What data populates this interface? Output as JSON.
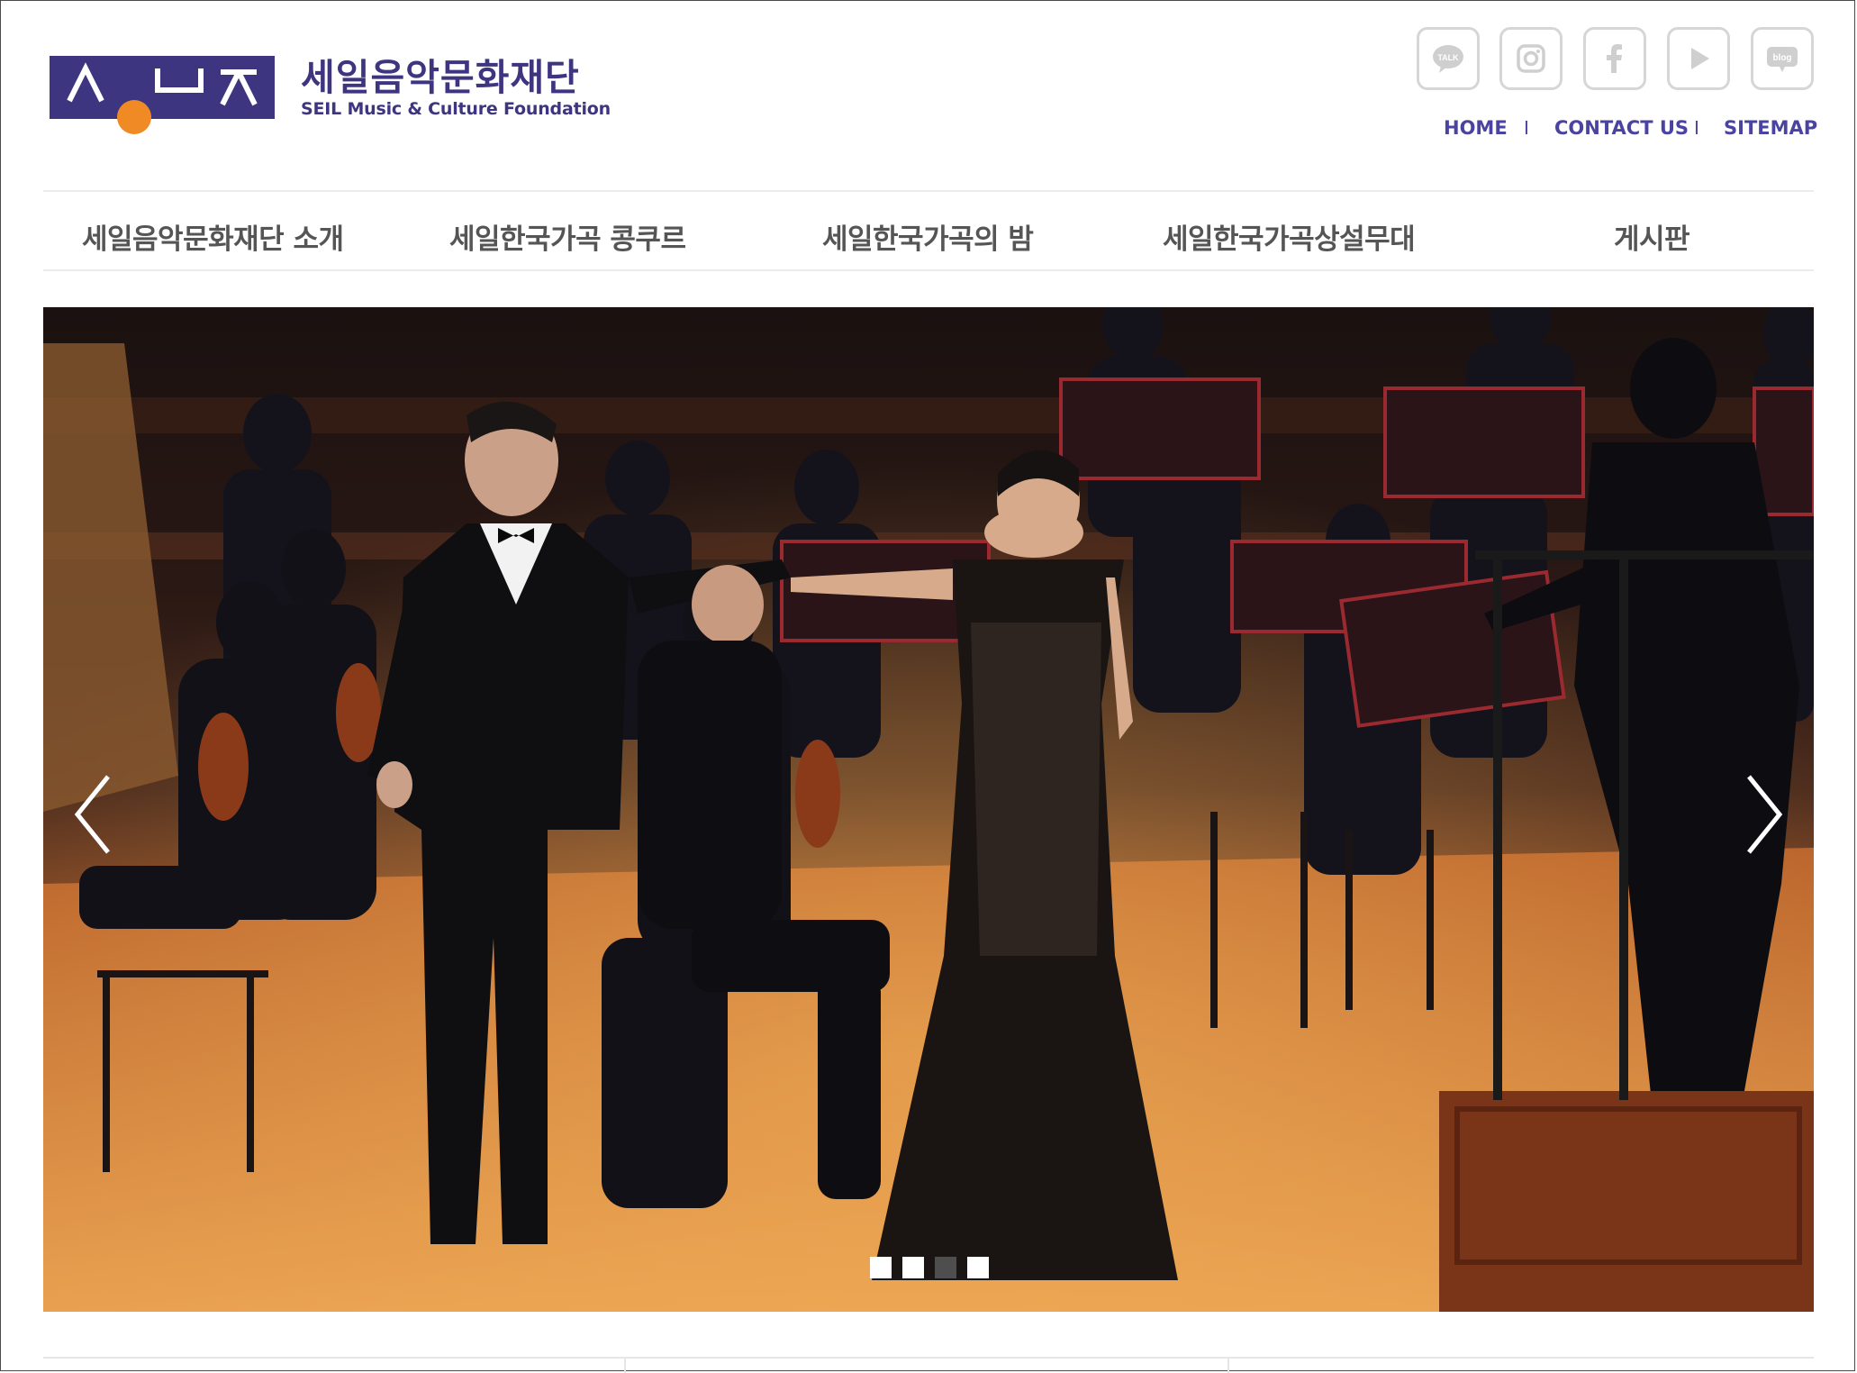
{
  "header": {
    "org_name_ko": "세일음악문화재단",
    "org_name_en": "SEIL Music & Culture Foundation",
    "brand_color": "#3e3580",
    "logo_dot_color": "#f08a24",
    "social": [
      {
        "name": "kakaotalk-icon",
        "label": "TALK"
      },
      {
        "name": "instagram-icon",
        "label": ""
      },
      {
        "name": "facebook-icon",
        "label": "f"
      },
      {
        "name": "youtube-icon",
        "label": ""
      },
      {
        "name": "blog-icon",
        "label": "blog"
      }
    ],
    "util_links": {
      "home": "HOME",
      "contact": "CONTACT US",
      "sitemap": "SITEMAP",
      "separator": "I"
    }
  },
  "nav": {
    "items": [
      "세일음악문화재단 소개",
      "세일한국가곡 콩쿠르",
      "세일한국가곡의 밤",
      "세일한국가곡상설무대",
      "게시판"
    ]
  },
  "slider": {
    "total_slides": 4,
    "active_slide": 3,
    "prev_icon": "chevron-left-icon",
    "next_icon": "chevron-right-icon"
  }
}
